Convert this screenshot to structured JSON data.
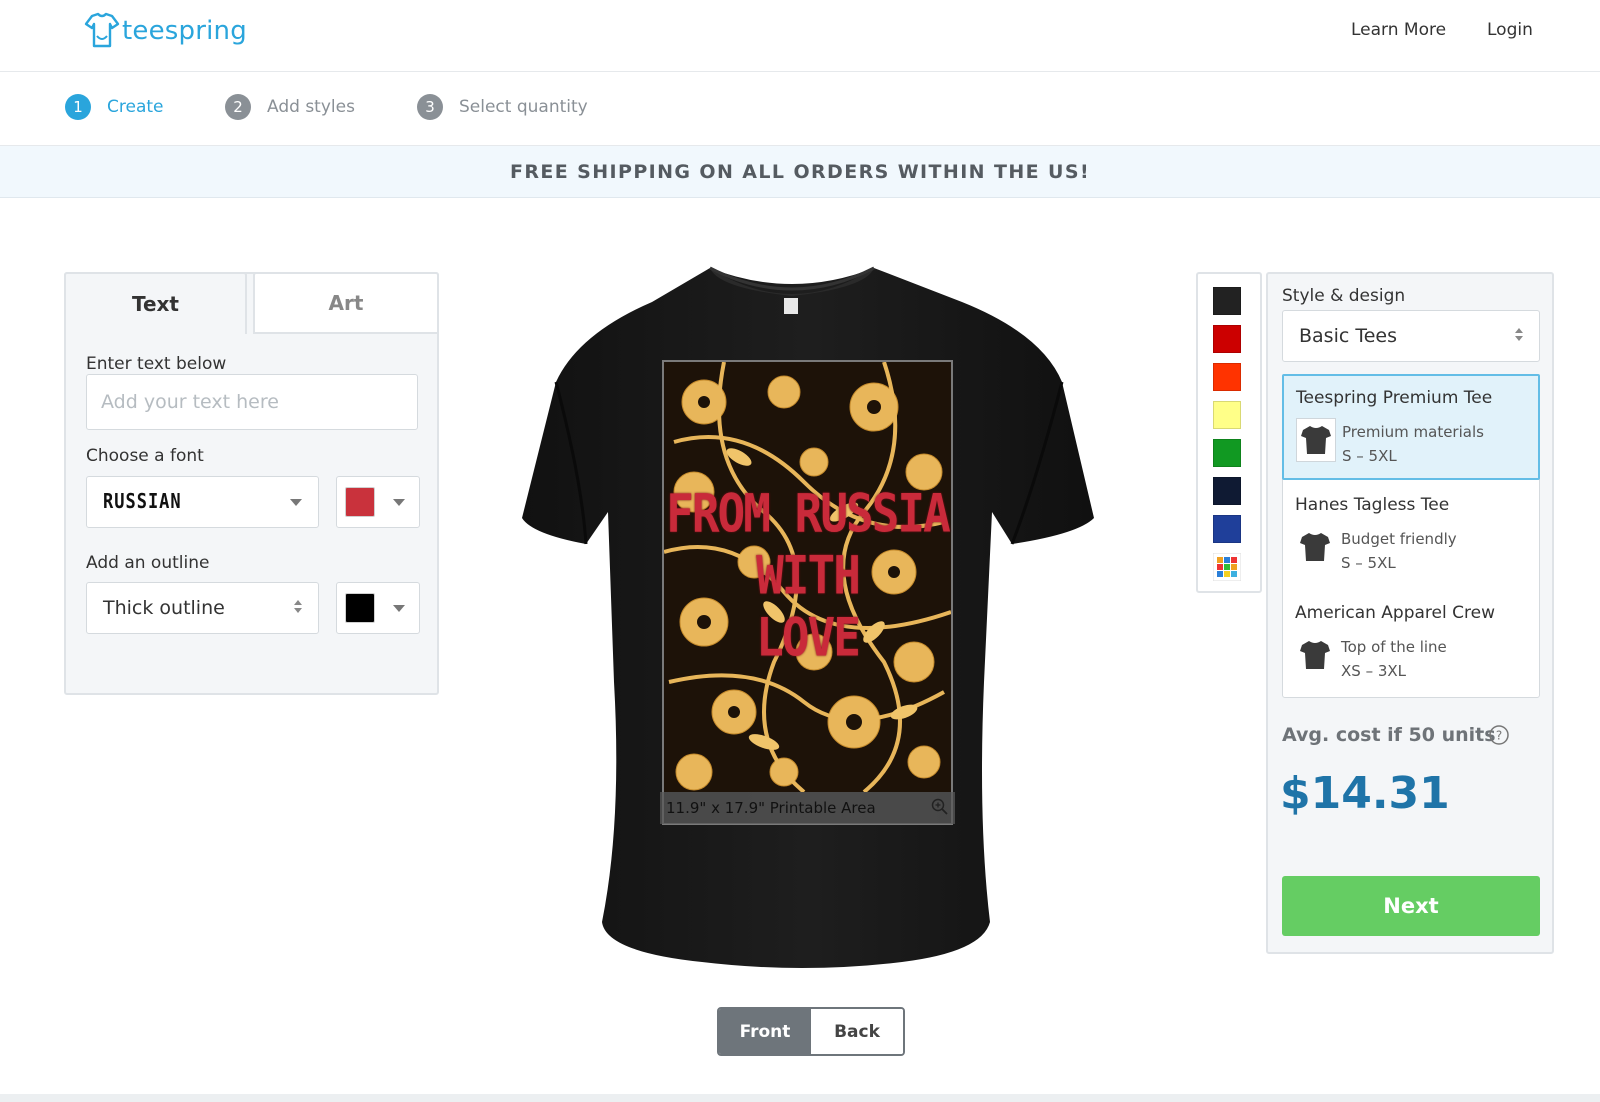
{
  "header": {
    "brand": "teespring",
    "nav": [
      "Learn More",
      "Login"
    ]
  },
  "steps": [
    {
      "num": "1",
      "label": "Create",
      "active": true
    },
    {
      "num": "2",
      "label": "Add styles",
      "active": false
    },
    {
      "num": "3",
      "label": "Select quantity",
      "active": false
    }
  ],
  "banner": "FREE SHIPPING ON ALL ORDERS WITHIN THE US!",
  "editor": {
    "tabs": [
      "Text",
      "Art"
    ],
    "active_tab": "Text",
    "enter_text_label": "Enter text below",
    "text_placeholder": "Add your text here",
    "font_label": "Choose a font",
    "font_value": "RUSSIAN",
    "font_color": "#c9323c",
    "outline_label": "Add an outline",
    "outline_value": "Thick outline",
    "outline_color": "#000000"
  },
  "mockup": {
    "design_lines": [
      "FROM RUSSIA",
      "WITH",
      "LOVE"
    ],
    "printable_area": "11.9\" x 17.9\" Printable Area",
    "view_buttons": [
      "Front",
      "Back"
    ],
    "active_view": "Front"
  },
  "shirt_colors": [
    "#222222",
    "#cc0000",
    "#ff3300",
    "#ffff88",
    "#119922",
    "#0f1a33",
    "#1f3f9a",
    "more-colors-icon"
  ],
  "style": {
    "label": "Style & design",
    "selected": "Basic Tees",
    "products": [
      {
        "name": "Teespring Premium Tee",
        "desc": "Premium materials",
        "sizes": "S – 5XL",
        "selected": true
      },
      {
        "name": "Hanes Tagless Tee",
        "desc": "Budget friendly",
        "sizes": "S – 5XL",
        "selected": false
      },
      {
        "name": "American Apparel Crew",
        "desc": "Top of the line",
        "sizes": "XS – 3XL",
        "selected": false
      }
    ],
    "avg_cost_label": "Avg. cost if 50 units",
    "price": "$14.31",
    "next_label": "Next"
  },
  "colors": {
    "brand": "#2aa5dc",
    "step_active": "#2aa5dc",
    "step_inactive": "#8a9096",
    "price": "#1f74a8",
    "next_button": "#65cd63"
  }
}
